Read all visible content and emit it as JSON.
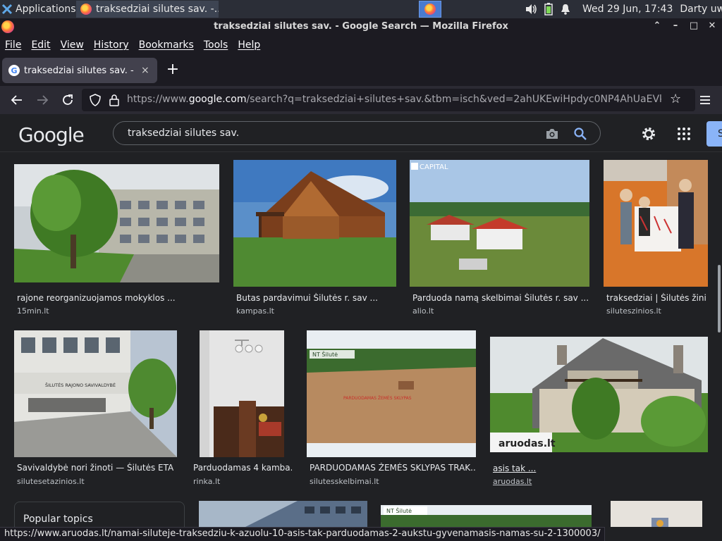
{
  "taskbar": {
    "applications_label": "Applications",
    "task_title": "traksedziai silutes sav. -...",
    "clock": "Wed 29 Jun, 17:43",
    "user": "Darty uwu"
  },
  "window": {
    "title": "traksedziai silutes sav. - Google Search — Mozilla Firefox",
    "buttons": [
      "⌃",
      "–",
      "□",
      "✕"
    ]
  },
  "menu": [
    "File",
    "Edit",
    "View",
    "History",
    "Bookmarks",
    "Tools",
    "Help"
  ],
  "tab": {
    "title": "traksedziai silutes sav. -",
    "close": "×",
    "new_tab": "+"
  },
  "navigation": {
    "url_prefix": "https://www.",
    "url_domain": "google.com",
    "url_rest": "/search?q=traksedziai+silutes+sav.&tbm=isch&ved=2ahUKEwiHpdyc0NP4AhUaEVk"
  },
  "google": {
    "logo": "Google",
    "query": "traksedziai silutes sav.",
    "signin_initial": "S"
  },
  "results": [
    {
      "caption": "rajone reorganizuojamos mokyklos ...",
      "source": "15min.lt"
    },
    {
      "caption": "Butas pardavimui Šilutės r. sav ...",
      "source": "kampas.lt"
    },
    {
      "caption": "Parduoda namą skelbimai Šilutės r. sav ...",
      "source": "alio.lt"
    },
    {
      "caption": "traksedziai | Šilutės žini...",
      "source": "siluteszinios.lt"
    },
    {
      "caption": "Savivaldybė nori žinoti — Šilutės ETA ...",
      "source": "silutesetazinios.lt"
    },
    {
      "caption": "Parduodamas 4 kamba...",
      "source": "rinka.lt"
    },
    {
      "caption": "PARDUODAMAS ŽEMĖS SKLYPAS TRAK...",
      "source": "silutesskelbimai.lt"
    },
    {
      "caption": "asis tak ...",
      "source": "aruodas.lt"
    }
  ],
  "image_text": {
    "capital": "CAPITAL",
    "nt_silute": "NT Šilutė",
    "nt_silute_2": "NT Šilutė",
    "aruodas": "aruodas.lt",
    "savivaldybe": "ŠILUTĖS RAJONO SAVIVALDYBĖ",
    "sklypas": "PARDUODAMAS ŽEMĖS SKLYPAS"
  },
  "popular_topics": "Popular topics",
  "status_url": "https://www.aruodas.lt/namai-siluteje-traksedziu-k-azuolu-10-asis-tak-parduodamas-2-aukstu-gyvenamasis-namas-su-2-1300003/",
  "colors": {
    "background": "#202124",
    "chrome": "#1c1b22",
    "accent": "#8ab4f8"
  }
}
